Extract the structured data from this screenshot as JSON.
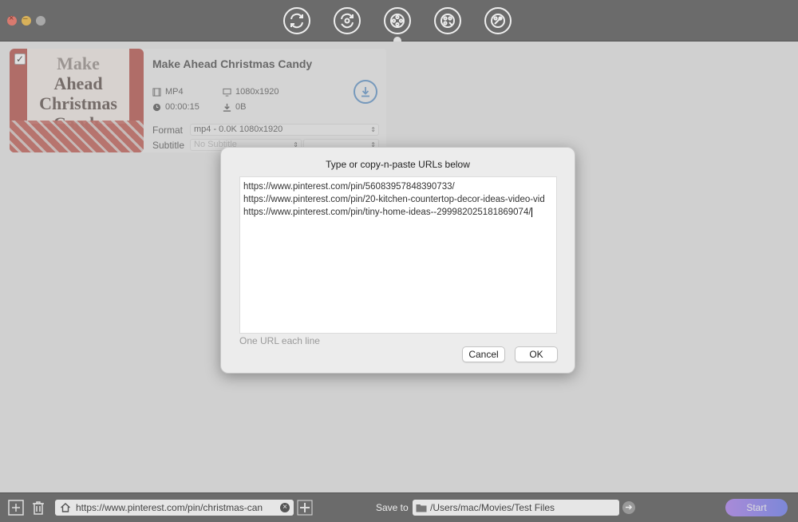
{
  "window": {
    "toolbar_icons": [
      "convert-icon",
      "refresh-convert-icon",
      "download-film-icon",
      "edit-film-icon",
      "effects-film-icon"
    ]
  },
  "item": {
    "thumbnail_text": [
      "Make",
      "Ahead",
      "Christmas",
      "Candy"
    ],
    "title": "Make Ahead Christmas Candy",
    "format": "MP4",
    "resolution": "1080x1920",
    "duration": "00:00:15",
    "size": "0B",
    "format_label": "Format",
    "format_value": "mp4 - 0.0K 1080x1920",
    "subtitle_label": "Subtitle",
    "subtitle_value": "No Subtitle"
  },
  "dialog": {
    "title": "Type or copy-n-paste URLs below",
    "urls": [
      "https://www.pinterest.com/pin/560839578483907​33/",
      "https://www.pinterest.com/pin/20-kitchen-countertop-decor-ideas-video-vid",
      "https://www.pinterest.com/pin/tiny-home-ideas--299982025181869074/"
    ],
    "hint": "One URL each line",
    "cancel_label": "Cancel",
    "ok_label": "OK"
  },
  "bottom": {
    "url_value": "https://www.pinterest.com/pin/christmas-can",
    "save_label": "Save to",
    "save_path": "/Users/mac/Movies/Test Files",
    "start_label": "Start"
  },
  "colors": {
    "accent_start": "#a98ad8",
    "accent_end": "#7c88d8",
    "download_blue": "#5b8ab8"
  }
}
